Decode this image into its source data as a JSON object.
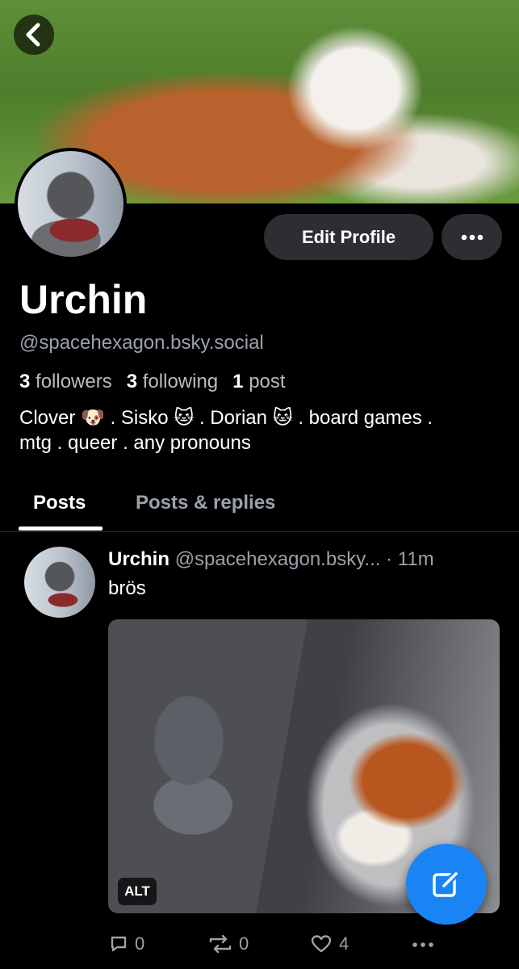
{
  "profile": {
    "display_name": "Urchin",
    "handle": "@spacehexagon.bsky.social",
    "followers_count": "3",
    "followers_label": "followers",
    "following_count": "3",
    "following_label": "following",
    "posts_count": "1",
    "posts_label": "post",
    "bio_line1": "Clover 🐶 . Sisko 🐱 . Dorian 🐱 . board games .",
    "bio_line2": "mtg . queer . any pronouns"
  },
  "header": {
    "back_icon": "chevron-left-icon",
    "edit_profile_label": "Edit Profile",
    "more_icon": "ellipsis-icon"
  },
  "tabs": [
    {
      "label": "Posts",
      "active": true
    },
    {
      "label": "Posts & replies",
      "active": false
    }
  ],
  "post": {
    "author_name": "Urchin",
    "author_handle": "@spacehexagon.bsky...",
    "time": "· 11m",
    "text": "brös",
    "alt_label": "ALT",
    "reply_count": "0",
    "repost_count": "0",
    "like_count": "4"
  },
  "colors": {
    "accent": "#1b84f5",
    "background": "#000000",
    "muted_text": "#9aa1ab",
    "button_bg": "#2c2e33"
  }
}
